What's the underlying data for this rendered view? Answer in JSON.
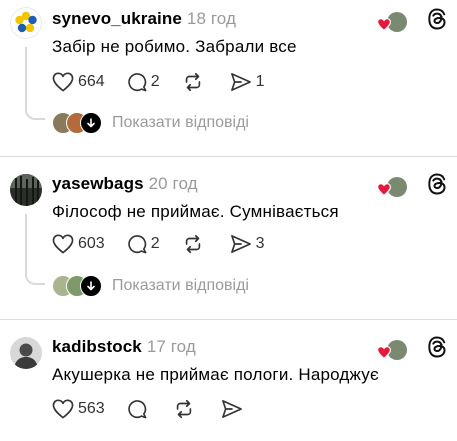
{
  "posts": [
    {
      "username": "synevo_ukraine",
      "time": "18 год",
      "text": "Забір не робимо. Забрали все",
      "likes": "664",
      "comments": "2",
      "reposts": "",
      "shares": "1",
      "show_replies": "Показати відповіді"
    },
    {
      "username": "yasewbags",
      "time": "20 год",
      "text": "Філософ не приймає. Сумнівається",
      "likes": "603",
      "comments": "2",
      "reposts": "",
      "shares": "3",
      "show_replies": "Показати відповіді"
    },
    {
      "username": "kadibstock",
      "time": "17 год",
      "text": "Акушерка не приймає пологи. Народжує",
      "likes": "563",
      "comments": "",
      "reposts": "",
      "shares": ""
    }
  ],
  "icons": [
    "heart-icon",
    "comment-icon",
    "repost-icon",
    "share-icon",
    "threads-logo-icon",
    "liked-by-author-icon",
    "arrow-down-icon"
  ],
  "colors": {
    "like_red": "#e5193b",
    "muted_text": "#9a9a9a",
    "thread_line": "#d9d9d9",
    "brand_blue": "#1d5fb5",
    "brand_yellow": "#f5c400"
  }
}
